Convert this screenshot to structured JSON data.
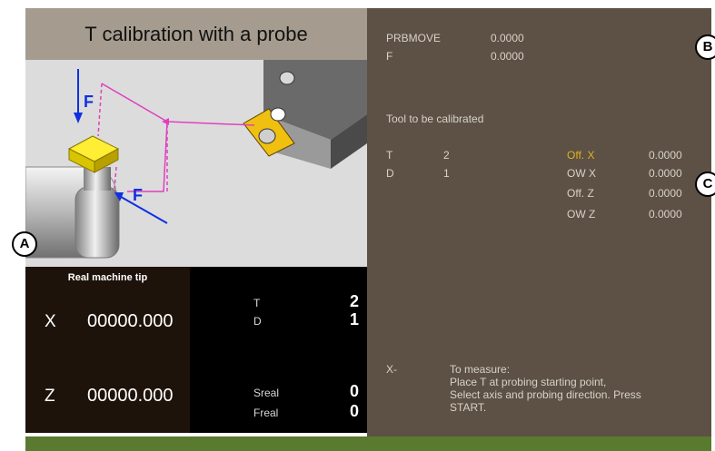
{
  "title": "T calibration with a probe",
  "diagram": {
    "force_label": "F"
  },
  "coords": {
    "header": "Real machine tip",
    "x_label": "X",
    "x_value": "00000.000",
    "z_label": "Z",
    "z_value": "00000.000"
  },
  "tool_info": {
    "t_label": "T",
    "t_value": "2",
    "d_label": "D",
    "d_value": "1",
    "sreal_label": "Sreal",
    "sreal_value": "0",
    "freal_label": "Freal",
    "freal_value": "0"
  },
  "probe_move": {
    "prbmove_label": "PRBMOVE",
    "prbmove_value": "0.0000",
    "f_label": "F",
    "f_value": "0.0000"
  },
  "tool_section": {
    "heading": "Tool to be calibrated",
    "t_label": "T",
    "t_value": "2",
    "d_label": "D",
    "d_value": "1",
    "offsets": [
      {
        "label": "Off. X",
        "value": "0.0000",
        "highlight": true
      },
      {
        "label": "OW X",
        "value": "0.0000",
        "highlight": false
      },
      {
        "label": "Off. Z",
        "value": "0.0000",
        "highlight": false
      },
      {
        "label": "OW Z",
        "value": "0.0000",
        "highlight": false
      }
    ]
  },
  "instructions": {
    "axis_dir": "X-",
    "line1": "To measure:",
    "line2": "Place T at probing starting point,",
    "line3": "Select axis and probing direction. Press",
    "line4": "START."
  },
  "callouts": {
    "a": "A",
    "b": "B",
    "c": "C"
  },
  "colors": {
    "title_bg": "#a59c8f",
    "right_panel_bg": "#5c5144",
    "highlight_yellow": "#e0b020",
    "status_green": "#5a7a30",
    "path_magenta": "#e040c0",
    "arrow_blue": "#1030e0"
  }
}
